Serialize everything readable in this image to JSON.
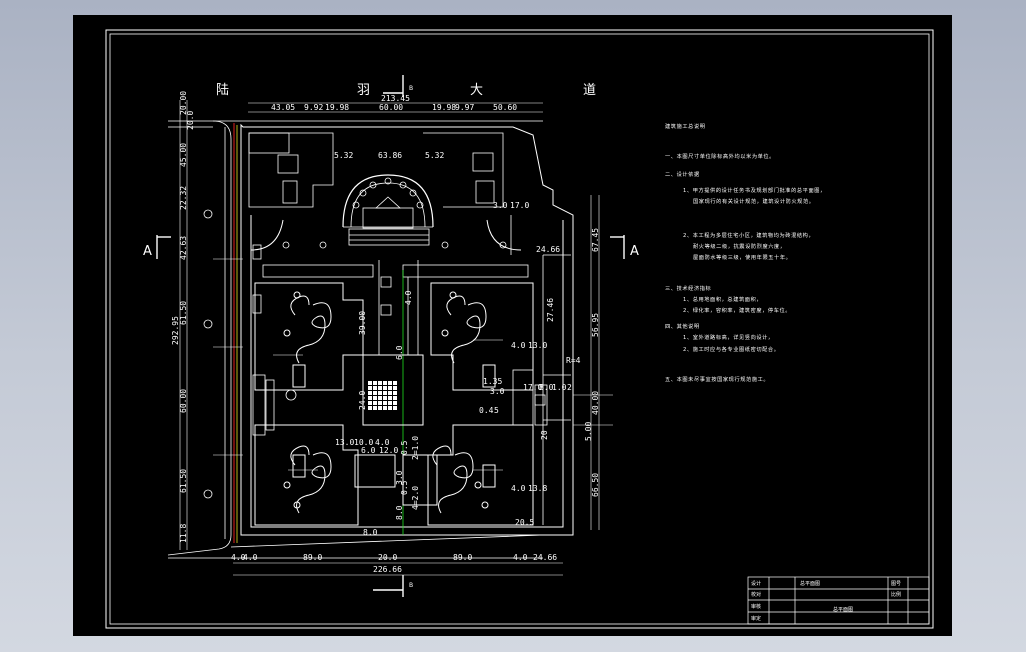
{
  "colors": {
    "window_bg": "#aab2c3",
    "canvas_bg": "#000000",
    "line_white": "#ffffff",
    "line_green": "#20e020",
    "line_yellow": "#e0e020",
    "line_red": "#e02020"
  },
  "road_label": {
    "chars": [
      "陆",
      "羽",
      "大",
      "道"
    ]
  },
  "section_marks": {
    "a": "A",
    "b": "B"
  },
  "dims_top": [
    "213.45",
    "43.05",
    "9.92",
    "19.98",
    "60.00",
    "19.98",
    "9.97",
    "50.60"
  ],
  "dims_bottom": [
    "4.0",
    "4.0",
    "89.0",
    "20.0",
    "89.0",
    "4.0",
    "24.66",
    "226.66"
  ],
  "dims_left": [
    "20.00",
    "20.0",
    "45.00",
    "22.32",
    "42.63",
    "61.50",
    "292.95",
    "60.00",
    "61.50",
    "11.8"
  ],
  "dims_right": [
    "67.45",
    "56.95",
    "40.00",
    "5.00",
    "66.50"
  ],
  "dims_inner": {
    "top_mid": [
      "5.32",
      "63.86",
      "5.32"
    ],
    "right_upper": [
      "3.0",
      "17.0",
      "24.66",
      "27.46",
      "4.0",
      "13.0",
      "R=4",
      "1.35",
      "3.0",
      "17.0",
      "8.0",
      "1.0",
      "2",
      "0.4",
      "5",
      "20",
      "4.0",
      "13.8",
      "20.5",
      "8.0"
    ],
    "center": [
      "39.00",
      "24.0",
      "13.0",
      "10.0",
      "4.0",
      "6.0",
      "12.0",
      "0.5",
      "2=1.0",
      "0.5",
      "4=2.0",
      "8.0",
      "3.0",
      "6.0",
      "4.0"
    ]
  },
  "notes": {
    "title": "建筑施工总说明",
    "lines": [
      "一、本图尺寸单位除标高外均以米为单位。",
      "二、设计依据",
      "1、甲方提供的设计任务书及规划部门批准的总平面图，",
      "国家现行的有关设计规范，建筑设计防火规范。",
      "2、本工程为多层住宅小区，建筑物均为砖混结构，",
      "耐火等级二级，抗震设防烈度六度，",
      "屋面防水等级三级，使用年限五十年。",
      "三、技术经济指标",
      "1、总用地面积，总建筑面积，",
      "2、绿化率，容积率，建筑密度，停车位。",
      "四、其他说明",
      "1、室外道路标高，详见竖向设计，",
      "2、施工时应与各专业图纸密切配合。",
      "五、本图未尽事宜按国家现行规范施工。"
    ]
  },
  "title_block": {
    "rows": [
      [
        "设计",
        "",
        "总平面图",
        "",
        "",
        "图号"
      ],
      [
        "校对",
        "",
        "",
        "",
        "",
        "比例"
      ],
      [
        "审核",
        "",
        "",
        "",
        "",
        ""
      ],
      [
        "审定",
        "",
        "",
        "",
        "",
        ""
      ]
    ],
    "sheet_label": "总平面图"
  }
}
